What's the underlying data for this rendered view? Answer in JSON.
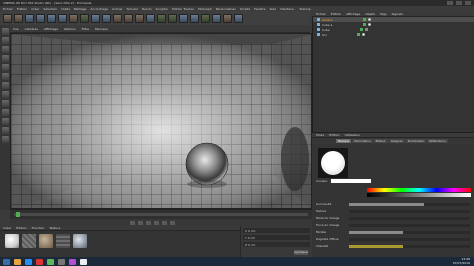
{
  "window": {
    "title": "CINEMA 4D R17.032 Studio (RC) - [Sans titre 2] - Principale"
  },
  "menubar": [
    "Fichier",
    "Édition",
    "Créer",
    "Sélection",
    "Outils",
    "Maillage",
    "Accrochage",
    "Animer",
    "Simuler",
    "Rendu",
    "Sculpter",
    "Motion Tracker",
    "MoGraph",
    "Personnaliser",
    "Scripts",
    "Fenêtre",
    "Aide",
    "Interface :",
    "Startup"
  ],
  "viewport": {
    "menu": [
      "Vue",
      "Caméras",
      "Affichage",
      "Options",
      "Filtre",
      "Panneau"
    ]
  },
  "materials_bar": {
    "items": [
      "Créer",
      "Édition",
      "Fonction",
      "Texture"
    ]
  },
  "object_manager": {
    "menu": [
      "Fichier",
      "Édition",
      "Affichage",
      "Objets",
      "Tags",
      "Signets"
    ],
    "objects": [
      {
        "name": "Sphère",
        "selected": true
      },
      {
        "name": "Cube.1",
        "selected": false
      },
      {
        "name": "Cube",
        "selected": false
      },
      {
        "name": "Sol",
        "selected": false
      }
    ]
  },
  "attributes": {
    "menu": [
      "Mode",
      "Édition",
      "Utilisateur"
    ],
    "section": "Matériau [Mat]",
    "tabs": [
      "Basique",
      "Illumination",
      "Éditeur",
      "Assigner",
      "Illumination",
      "Réflectance"
    ],
    "active_tab": "Basique",
    "color_label": "Couleur",
    "sliders": [
      {
        "label": "Luminosité",
        "value": 0.62,
        "yellow": false
      },
      {
        "label": "Texture",
        "value": 0.0,
        "yellow": false
      },
      {
        "label": "Mode de mixage",
        "value": 0.0,
        "yellow": false
      },
      {
        "label": "Force du mixage",
        "value": 0.0,
        "yellow": false
      },
      {
        "label": "Modèle",
        "value": 0.45,
        "yellow": false
      },
      {
        "label": "Rugosité diffuse",
        "value": 0.0,
        "yellow": false
      },
      {
        "label": "Intensité",
        "value": 0.45,
        "yellow": true
      }
    ]
  },
  "coords": {
    "rows": [
      "X 0 cm",
      "Y 0 cm",
      "Z 0 cm"
    ],
    "apply": "Appliquer"
  },
  "taskbar": {
    "time": "13:48",
    "date": "07/07/2016"
  },
  "colors": {
    "accent": "#f0a030",
    "timeline_marker": "#4fae4f"
  }
}
